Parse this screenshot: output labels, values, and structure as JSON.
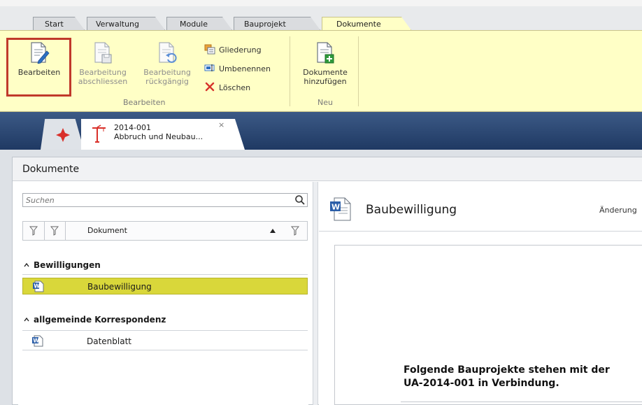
{
  "ribbon": {
    "tabs": [
      {
        "label": "Start"
      },
      {
        "label": "Verwaltung"
      },
      {
        "label": "Module"
      },
      {
        "label": "Bauprojekt"
      },
      {
        "label": "Dokumente",
        "active": true
      }
    ],
    "groups": {
      "bearbeiten": {
        "label": "Bearbeiten",
        "edit_label": "Bearbeiten",
        "finish_label_1": "Bearbeitung",
        "finish_label_2": "abschliessen",
        "undo_label_1": "Bearbeitung",
        "undo_label_2": "rückgängig",
        "structure_label": "Gliederung",
        "rename_label": "Umbenennen",
        "delete_label": "Löschen"
      },
      "neu": {
        "label": "Neu",
        "add_docs_label_1": "Dokumente",
        "add_docs_label_2": "hinzufügen"
      }
    }
  },
  "doc_tabs": {
    "project_number": "2014-001",
    "project_name": "Abbruch und Neubau...",
    "close_glyph": "×"
  },
  "panel": {
    "title": "Dokumente",
    "search": {
      "placeholder": "Suchen"
    },
    "columns": {
      "document": "Dokument"
    },
    "groups": [
      {
        "label": "Bewilligungen",
        "items": [
          {
            "name": "Baubewilligung",
            "selected": true
          }
        ]
      },
      {
        "label": "allgemeinde Korrespondenz",
        "items": [
          {
            "name": "Datenblatt",
            "selected": false
          }
        ]
      }
    ]
  },
  "detail": {
    "title": "Baubewilligung",
    "changes_label": "Änderung",
    "preview_line1": "Folgende Bauprojekte stehen mit der",
    "preview_line2": "UA-2014-001 in Verbindung."
  },
  "colors": {
    "ribbon_bg": "#ffffc6",
    "selection": "#d9d73a",
    "highlight_border": "#c0392b",
    "doc_strip": "#2c4a78"
  }
}
